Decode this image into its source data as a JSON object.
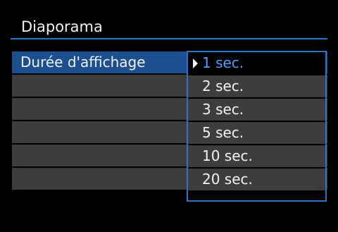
{
  "header": {
    "title": "Diaporama"
  },
  "menu": {
    "setting_label": "Durée d'affichage",
    "options": [
      {
        "label": "1 sec.",
        "selected": true
      },
      {
        "label": "2 sec.",
        "selected": false
      },
      {
        "label": "3 sec.",
        "selected": false
      },
      {
        "label": "5 sec.",
        "selected": false
      },
      {
        "label": "10 sec.",
        "selected": false
      },
      {
        "label": "20 sec.",
        "selected": false
      }
    ]
  },
  "colors": {
    "accent": "#2a74c8",
    "selected_text": "#4aa0ff",
    "row_bg": "#3d3d3d",
    "selected_row_bg": "#1c4f8f"
  }
}
